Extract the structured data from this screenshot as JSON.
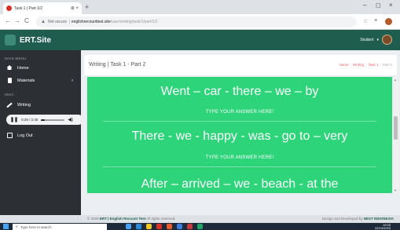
{
  "browser": {
    "tab_title": "Task 1 | Part 1/2",
    "tab_controls": "⊕ ×",
    "new_tab": "+",
    "window_controls": [
      "–",
      "◻",
      "×"
    ],
    "nav": [
      "←",
      "→",
      "C"
    ],
    "security_label": "Not secure",
    "url_domain": "englishrecounttest.site",
    "url_path": "/user/writing/task/1/part/1/2"
  },
  "app": {
    "brand": "ERT.Site",
    "user_name": "Student",
    "user_caret": "▾"
  },
  "sidebar": {
    "main_menu_label": "MAIN MENU",
    "misc_label": "MISC",
    "items": [
      {
        "label": "Home",
        "icon": "home-icon"
      },
      {
        "label": "Materials",
        "icon": "document-icon",
        "has_arrow": true,
        "arrow": "›"
      },
      {
        "label": "Writing",
        "icon": "pen-icon"
      },
      {
        "label": "Log Out",
        "icon": "logout-icon"
      }
    ]
  },
  "audio": {
    "current": "0:26",
    "duration": "2:45",
    "time_display": "0:26 / 2:45",
    "progress": 0.16
  },
  "page": {
    "title": "Writing | Task 1 - Part 2",
    "breadcrumb": [
      "Home",
      "Writing",
      "Task 1",
      "Part 2"
    ],
    "breadcrumb_sep": "›"
  },
  "questions": [
    {
      "sentence": "Went – car - there – we – by",
      "hint": "TYPE YOUR ANSWER HERE!"
    },
    {
      "sentence": "There - we - happy - was - go to – very",
      "hint": "TYPE YOUR ANSWER HERE!"
    },
    {
      "sentence": "After – arrived – we - beach - at the",
      "hint": ""
    }
  ],
  "footer": {
    "copyright_prefix": "© 2020",
    "copyright_brand": "ERT | English Recount Test",
    "copyright_suffix": "All rights reserved.",
    "credit_prefix": "Design and Developed by",
    "credit_brand": "NEST INDONESIA"
  },
  "taskbar": {
    "search_placeholder": "Type here to search",
    "time": "19:05",
    "date": "22/10/2020"
  },
  "colors": {
    "brand_dark": "#1f5d4f",
    "panel_green": "#2ed47a",
    "sidebar_bg": "#2c2f33",
    "breadcrumb": "#e8616a"
  }
}
